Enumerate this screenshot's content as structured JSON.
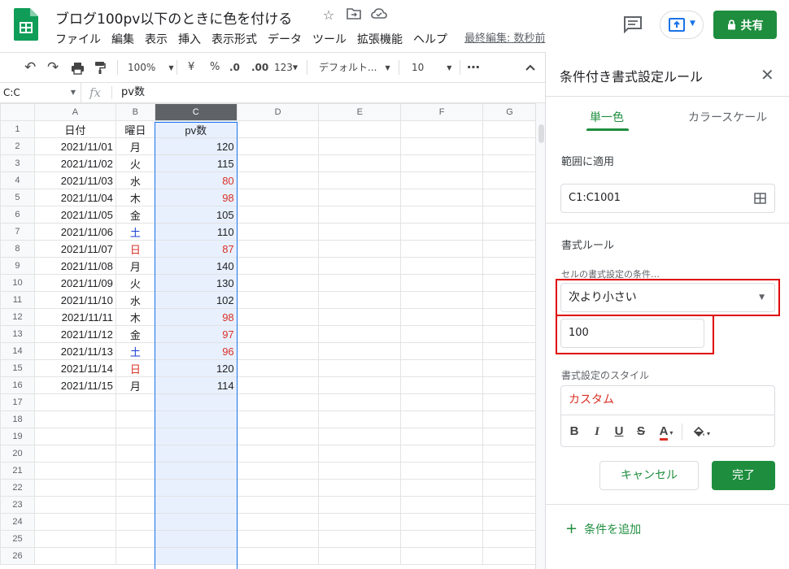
{
  "doc": {
    "title": "ブログ100pv以下のときに色を付ける",
    "last_edit": "最終編集: 数秒前"
  },
  "menu": [
    "ファイル",
    "編集",
    "表示",
    "挿入",
    "表示形式",
    "データ",
    "ツール",
    "拡張機能",
    "ヘルプ"
  ],
  "header": {
    "share_label": "共有",
    "title_icons": [
      "star-icon",
      "move-folder-icon",
      "cloud-saved-icon"
    ]
  },
  "toolbar": {
    "zoom": "100%",
    "currency": "¥",
    "percent": "%",
    "decrease_decimal": ".0",
    "increase_decimal": ".00",
    "more_formats": "123",
    "font": "デフォルト...",
    "font_size": "10",
    "more": "⋯"
  },
  "formula_bar": {
    "name_box": "C:C",
    "fx": "fx",
    "value": "pv数"
  },
  "sheet": {
    "columns": [
      "A",
      "B",
      "C",
      "D",
      "E",
      "F",
      "G"
    ],
    "rows": [
      [
        "日付",
        "曜日",
        "pv数"
      ],
      [
        "2021/11/01",
        "月",
        "120"
      ],
      [
        "2021/11/02",
        "火",
        "115"
      ],
      [
        "2021/11/03",
        "水",
        "80"
      ],
      [
        "2021/11/04",
        "木",
        "98"
      ],
      [
        "2021/11/05",
        "金",
        "105"
      ],
      [
        "2021/11/06",
        "土",
        "110"
      ],
      [
        "2021/11/07",
        "日",
        "87"
      ],
      [
        "2021/11/08",
        "月",
        "140"
      ],
      [
        "2021/11/09",
        "火",
        "130"
      ],
      [
        "2021/11/10",
        "水",
        "102"
      ],
      [
        "2021/11/11",
        "木",
        "98"
      ],
      [
        "2021/11/12",
        "金",
        "97"
      ],
      [
        "2021/11/13",
        "土",
        "96"
      ],
      [
        "2021/11/14",
        "日",
        "120"
      ],
      [
        "2021/11/15",
        "月",
        "114"
      ]
    ],
    "total_rows_visible": 26,
    "colors": {
      "below_threshold": "#d93025",
      "saturday": "#1a3fd0",
      "sunday": "#d93025",
      "selected_column": "#e8f0fe"
    }
  },
  "panel": {
    "title": "条件付き書式設定ルール",
    "tabs": [
      "単一色",
      "カラースケール"
    ],
    "apply_range_label": "範囲に適用",
    "apply_range_value": "C1:C1001",
    "format_rules_label": "書式ルール",
    "condition_label": "セルの書式設定の条件…",
    "condition_value": "次より小さい",
    "threshold_value": "100",
    "style_label": "書式設定のスタイル",
    "style_preview": "カスタム",
    "style_buttons": [
      "B",
      "I",
      "U",
      "S",
      "A"
    ],
    "cancel_label": "キャンセル",
    "done_label": "完了",
    "add_rule_label": "条件を追加"
  }
}
